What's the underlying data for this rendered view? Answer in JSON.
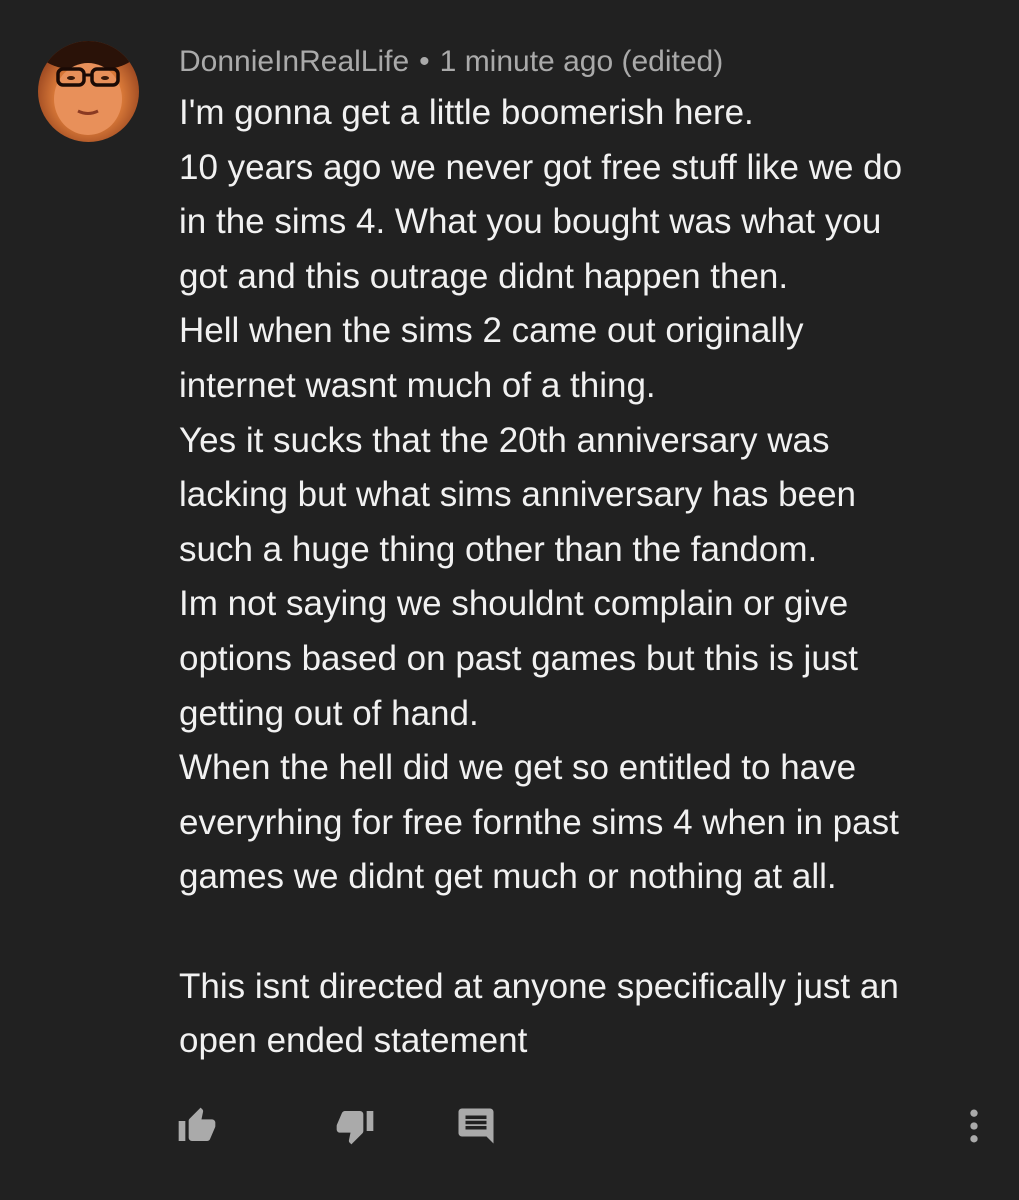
{
  "comment": {
    "author": "DonnieInRealLife",
    "separator": "•",
    "timestamp": "1 minute ago (edited)",
    "lines": [
      "I'm gonna get a little boomerish here.",
      "10 years ago we never got free stuff like we do",
      "in the sims 4. What you bought was what you",
      "got and this outrage didnt happen then.",
      "Hell when the sims 2 came out originally",
      "internet wasnt much of a thing.",
      "Yes it sucks that the 20th anniversary was",
      "lacking but what sims anniversary has been",
      "such a huge thing other than the fandom.",
      "Im not saying we shouldnt complain or give",
      "options based on past games but this is just",
      "getting out of hand.",
      "When the hell did we get so entitled to have",
      "everyrhing for free fornthe sims 4 when in past",
      "games we didnt get much or nothing at all.",
      "",
      "This isnt directed at anyone specifically just an",
      "open ended statement"
    ]
  },
  "actions": {
    "like_icon": "thumbs-up-icon",
    "dislike_icon": "thumbs-down-icon",
    "reply_icon": "reply-comment-icon",
    "more_icon": "more-vertical-icon"
  },
  "colors": {
    "background": "#212121",
    "text": "#f1f1f1",
    "meta": "#aaaaaa",
    "icon": "#aaaaaa"
  }
}
